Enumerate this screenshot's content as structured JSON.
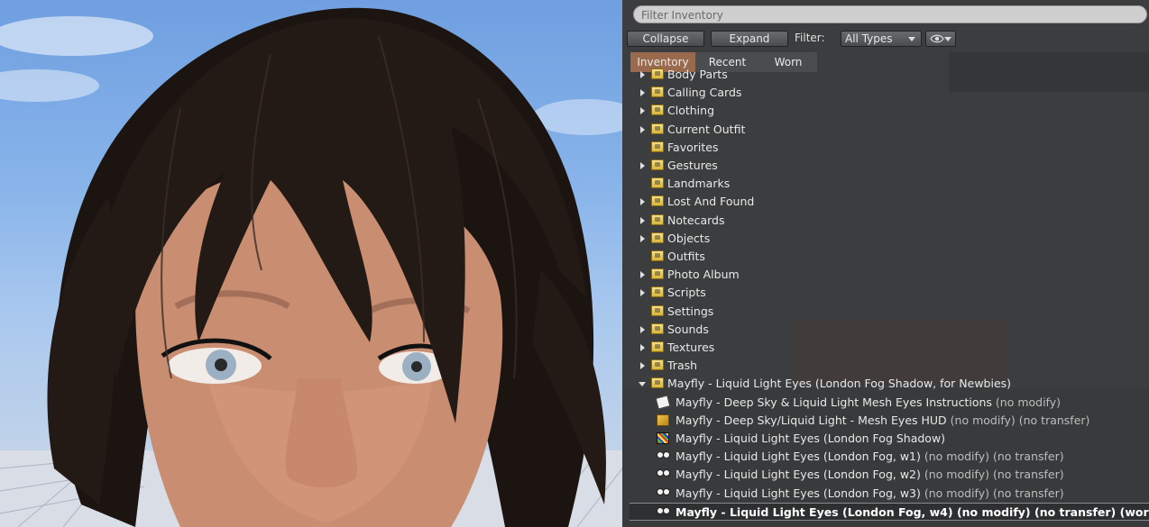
{
  "viewport": {
    "colors": {
      "sky": "#88b4ea",
      "hair": "#231a15",
      "skin": "#c88a70",
      "iris": "#9cb0c4"
    }
  },
  "inventory": {
    "filter_placeholder": "Filter Inventory",
    "collapse_label": "Collapse",
    "expand_label": "Expand",
    "filter_label": "Filter:",
    "type_select_value": "All Types",
    "tabs": [
      "Inventory",
      "Recent",
      "Worn"
    ],
    "active_tab": "Inventory",
    "folders": [
      {
        "label": "Body Parts",
        "expandable": true,
        "icon": "body-parts-folder-icon"
      },
      {
        "label": "Calling Cards",
        "expandable": true,
        "icon": "calling-cards-folder-icon"
      },
      {
        "label": "Clothing",
        "expandable": true,
        "icon": "clothing-folder-icon"
      },
      {
        "label": "Current Outfit",
        "expandable": true,
        "icon": "current-outfit-folder-icon"
      },
      {
        "label": "Favorites",
        "expandable": false,
        "icon": "favorites-folder-icon"
      },
      {
        "label": "Gestures",
        "expandable": true,
        "icon": "gestures-folder-icon"
      },
      {
        "label": "Landmarks",
        "expandable": false,
        "icon": "landmarks-folder-icon"
      },
      {
        "label": "Lost And Found",
        "expandable": true,
        "icon": "lost-and-found-folder-icon"
      },
      {
        "label": "Notecards",
        "expandable": true,
        "icon": "notecards-folder-icon"
      },
      {
        "label": "Objects",
        "expandable": true,
        "icon": "objects-folder-icon"
      },
      {
        "label": "Outfits",
        "expandable": false,
        "icon": "outfits-folder-icon"
      },
      {
        "label": "Photo Album",
        "expandable": true,
        "icon": "photo-album-folder-icon"
      },
      {
        "label": "Scripts",
        "expandable": true,
        "icon": "scripts-folder-icon"
      },
      {
        "label": "Settings",
        "expandable": false,
        "icon": "settings-folder-icon"
      },
      {
        "label": "Sounds",
        "expandable": true,
        "icon": "sounds-folder-icon"
      },
      {
        "label": "Textures",
        "expandable": true,
        "icon": "textures-folder-icon"
      },
      {
        "label": "Trash",
        "expandable": true,
        "icon": "trash-folder-icon"
      },
      {
        "label": "Mayfly - Liquid Light Eyes (London Fog Shadow, for Newbies)",
        "expandable": true,
        "expanded": true,
        "icon": "open-folder-icon"
      }
    ],
    "items": [
      {
        "label": "Mayfly - Deep Sky & Liquid Light Mesh Eyes Instructions",
        "suffix": " (no modify)",
        "icon": "notecard-icon"
      },
      {
        "label": "Mayfly - Deep Sky/Liquid Light - Mesh Eyes HUD",
        "suffix": " (no modify) (no transfer)",
        "icon": "object-box-icon"
      },
      {
        "label": "Mayfly - Liquid Light Eyes (London Fog Shadow)",
        "suffix": "",
        "icon": "texture-icon"
      },
      {
        "label": "Mayfly - Liquid Light Eyes (London Fog, w1)",
        "suffix": " (no modify) (no transfer)",
        "icon": "eyes-icon"
      },
      {
        "label": "Mayfly - Liquid Light Eyes (London Fog, w2)",
        "suffix": " (no modify) (no transfer)",
        "icon": "eyes-icon"
      },
      {
        "label": "Mayfly - Liquid Light Eyes (London Fog, w3)",
        "suffix": " (no modify) (no transfer)",
        "icon": "eyes-icon"
      },
      {
        "label": "Mayfly - Liquid Light Eyes (London Fog, w4)",
        "suffix": " (no modify) (no transfer) (worn)",
        "icon": "eyes-icon",
        "selected": true
      }
    ],
    "colors": {
      "panel_bg": "#3b3d3e",
      "active_tab": "#9a6a4f",
      "text": "#e9e9e9"
    }
  }
}
